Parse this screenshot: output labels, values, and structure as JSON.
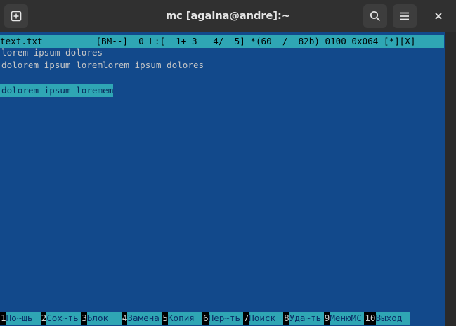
{
  "window": {
    "title": "mc [againa@andre]:~"
  },
  "editor": {
    "status": "text.txt          [BM--]  0 L:[  1+ 3   4/  5] *(60  /  82b) 0100 0x064 [*][X]",
    "lines": [
      "lorem ipsum dolores",
      "dolorem ipsum loremlorem ipsum dolores",
      "",
      "dolorem ipsum loremem"
    ]
  },
  "fkeys": [
    {
      "num": "1",
      "label": "По~щь"
    },
    {
      "num": "2",
      "label": "Сох~ть"
    },
    {
      "num": "3",
      "label": "Блок"
    },
    {
      "num": "4",
      "label": "Замена"
    },
    {
      "num": "5",
      "label": "Копия"
    },
    {
      "num": "6",
      "label": "Пер~ть"
    },
    {
      "num": "7",
      "label": "Поиск"
    },
    {
      "num": "8",
      "label": "Уда~ть"
    },
    {
      "num": "9",
      "label": "МенюМС"
    },
    {
      "num": "10",
      "label": "Выход"
    }
  ],
  "colors": {
    "terminal_bg": "#12498b",
    "accent_cyan": "#2fa6b4",
    "titlebar_bg": "#303030"
  }
}
